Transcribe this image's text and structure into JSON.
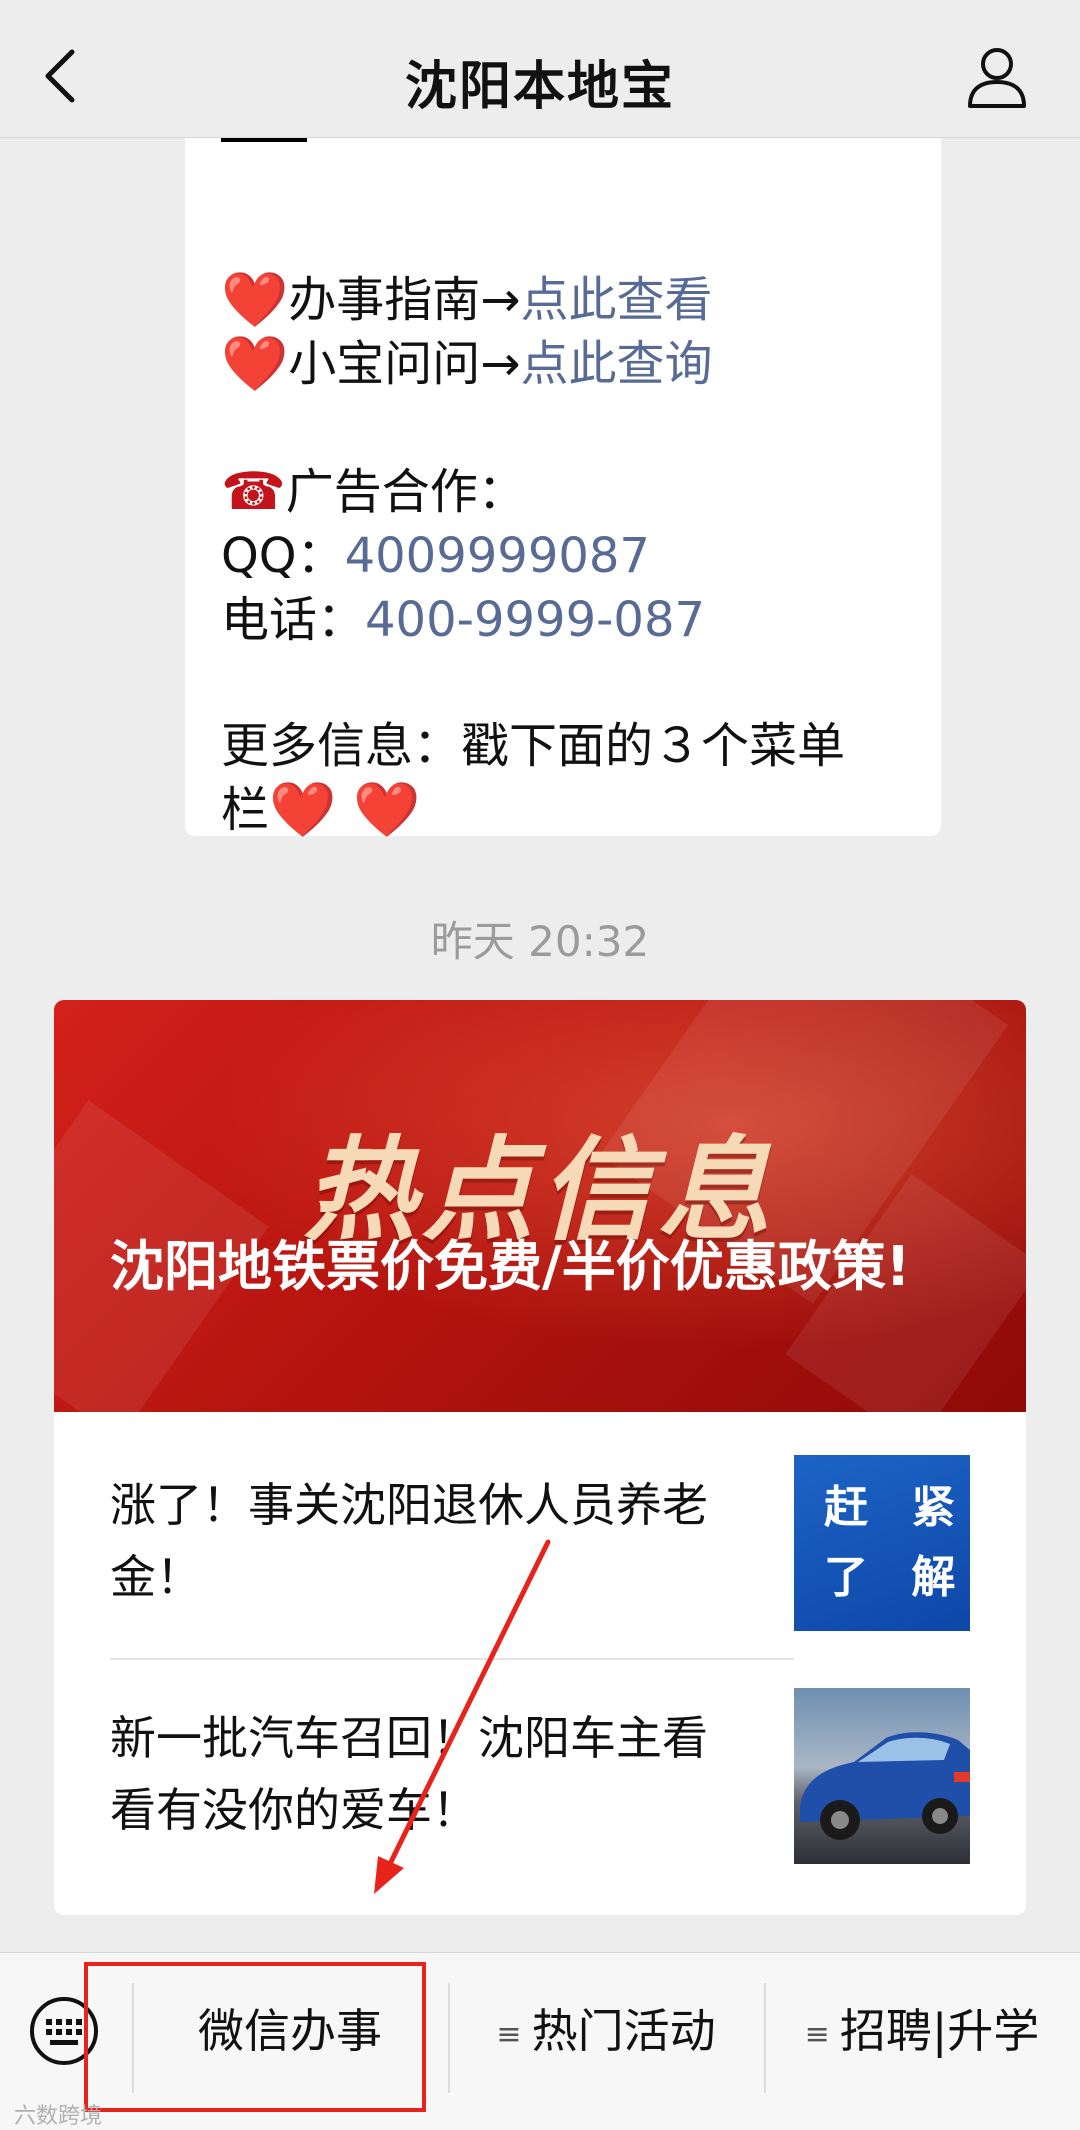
{
  "header": {
    "title": "沈阳本地宝"
  },
  "message": {
    "line1": {
      "heart": "❤️",
      "label": "办事指南",
      "arrow": "→",
      "link": "点此查看"
    },
    "line2": {
      "heart": "❤️",
      "label": "小宝问问",
      "arrow": "→",
      "link": "点此查询"
    },
    "ad_label": "广告合作：",
    "ad_icon": "☎",
    "qq_label": "QQ：",
    "qq_value": "4009999087",
    "phone_label": "电话：",
    "phone_value": "400-9999-087",
    "more_line1": "更多信息：戳下面的３个菜单",
    "more_line2": "栏",
    "more_hearts": "❤️ ❤️"
  },
  "timestamp": "昨天 20:32",
  "article": {
    "banner_title": "热点信息",
    "banner_headline": "沈阳地铁票价免费/半价优惠政策!",
    "items": [
      {
        "text": "涨了！事关沈阳退休人员养老金！",
        "thumb_text_line1": "赶 紧",
        "thumb_text_line2": "了 解"
      },
      {
        "text": "新一批汽车召回！沈阳车主看看有没你的爱车！"
      }
    ]
  },
  "menu": {
    "items": [
      {
        "label": "微信办事",
        "has_sub_icon": false
      },
      {
        "label": "热门活动",
        "has_sub_icon": true
      },
      {
        "label": "招聘|升学",
        "has_sub_icon": true
      }
    ],
    "sub_icon_glyph": "≡"
  },
  "watermark": "六数跨境",
  "colors": {
    "link": "#576b95",
    "heart": "#e0121f",
    "banner_red": "#c31a14",
    "annotation_red": "#e8231c"
  }
}
